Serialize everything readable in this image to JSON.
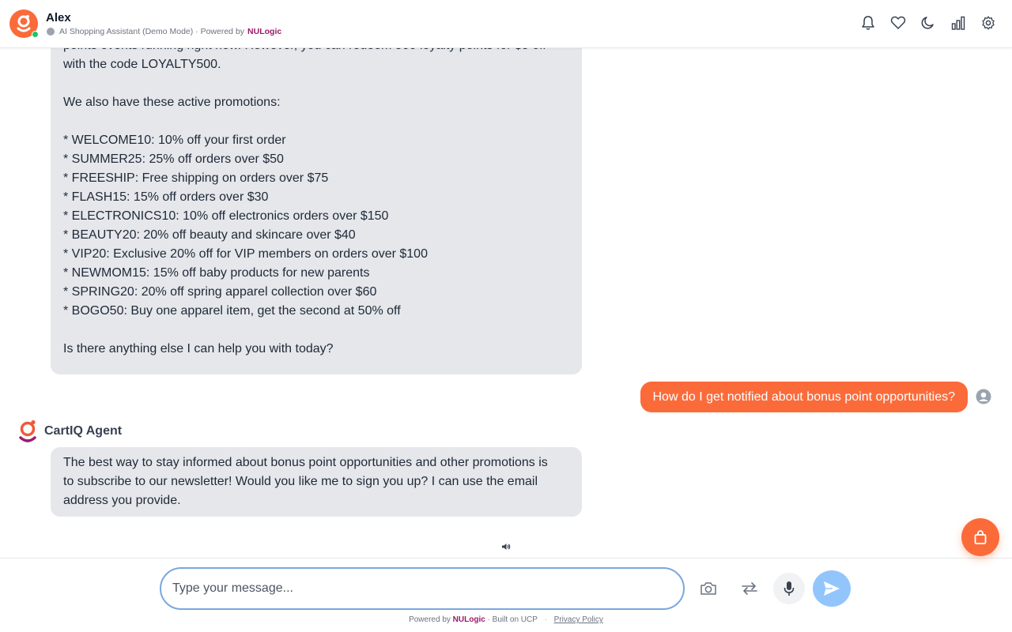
{
  "header": {
    "title": "Alex",
    "subtitle": "AI Shopping Assistant (Demo Mode) · Powered by",
    "brand": "NULogic",
    "icons": [
      "bell-icon",
      "heart-icon",
      "moon-icon",
      "chart-icon",
      "gear-icon"
    ]
  },
  "messages": {
    "bot1": "points events running right now. However, you can redeem 500 loyalty points for $5 off\nwith the code LOYALTY500.\n\nWe also have these active promotions:\n\n* WELCOME10: 10% off your first order\n* SUMMER25: 25% off orders over $50\n* FREESHIP: Free shipping on orders over $75\n* FLASH15: 15% off orders over $30\n* ELECTRONICS10: 10% off electronics orders over $150\n* BEAUTY20: 20% off beauty and skincare over $40\n* VIP20: Exclusive 20% off for VIP members on orders over $100\n* NEWMOM15: 15% off baby products for new parents\n* SPRING20: 20% off spring apparel collection over $60\n* BOGO50: Buy one apparel item, get the second at 50% off\n\nIs there anything else I can help you with today?",
    "user1": "How do I get notified about bonus point opportunities?",
    "agent_name": "CartIQ Agent",
    "bot2": "The best way to stay informed about bonus point opportunities and other promotions is\nto subscribe to our newsletter! Would you like me to sign you up? I can use the email\naddress you provide."
  },
  "input": {
    "placeholder": "Type your message...",
    "value": ""
  },
  "footer": {
    "powered_by": "Powered by",
    "brand": "NULogic",
    "built_on": "· Built on UCP",
    "separator": "·",
    "privacy": "Privacy Policy"
  },
  "colors": {
    "accent": "#fb6b3a",
    "brand": "#9b1b6a",
    "send": "#93c5fd",
    "bubble": "#e5e7eb"
  }
}
